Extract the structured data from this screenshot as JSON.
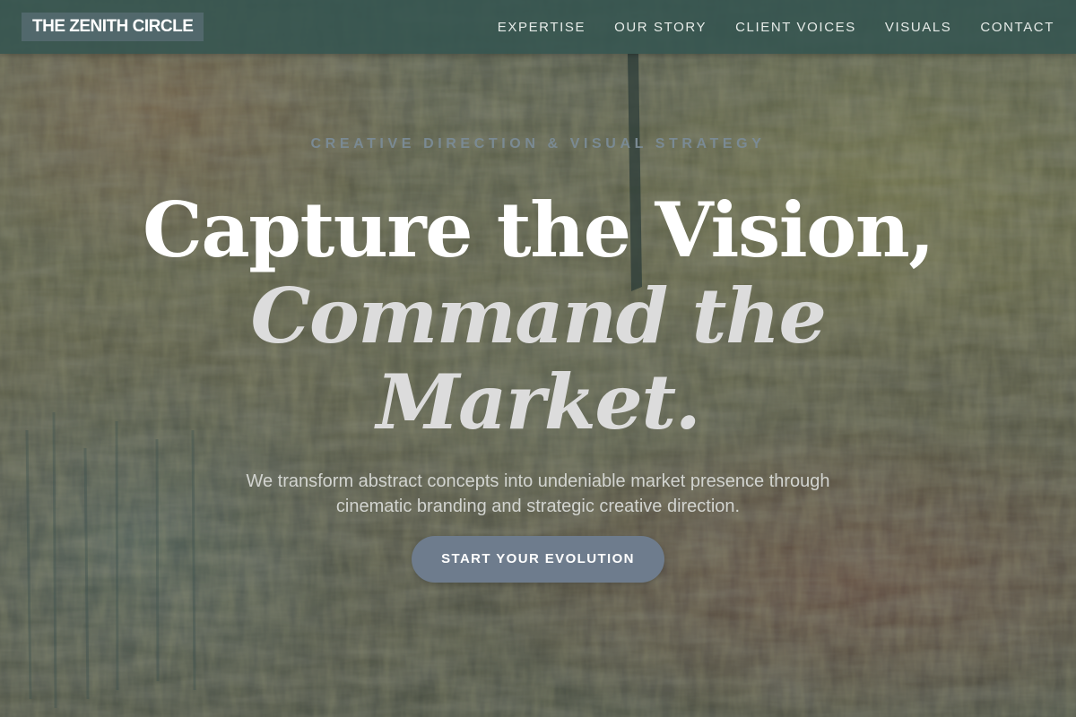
{
  "brand": {
    "logo_text": "THE ZENITH CIRCLE"
  },
  "nav": {
    "items": [
      {
        "label": "EXPERTISE"
      },
      {
        "label": "OUR STORY"
      },
      {
        "label": "CLIENT VOICES"
      },
      {
        "label": "VISUALS"
      },
      {
        "label": "CONTACT"
      }
    ]
  },
  "hero": {
    "eyebrow": "CREATIVE DIRECTION & VISUAL STRATEGY",
    "headline_line1": "Capture the Vision,",
    "headline_line2": "Command the",
    "headline_line3": "Market.",
    "subtitle": "We transform abstract concepts into undeniable market presence through cinematic branding and strategic creative direction.",
    "cta_label": "START YOUR EVOLUTION",
    "background": "textured oil painting"
  },
  "colors": {
    "nav_bg": "#345450",
    "cta_bg": "#6e7c8d",
    "eyebrow": "#7a8a93",
    "headline_primary": "#ffffff",
    "headline_secondary": "#dcdcdc"
  }
}
